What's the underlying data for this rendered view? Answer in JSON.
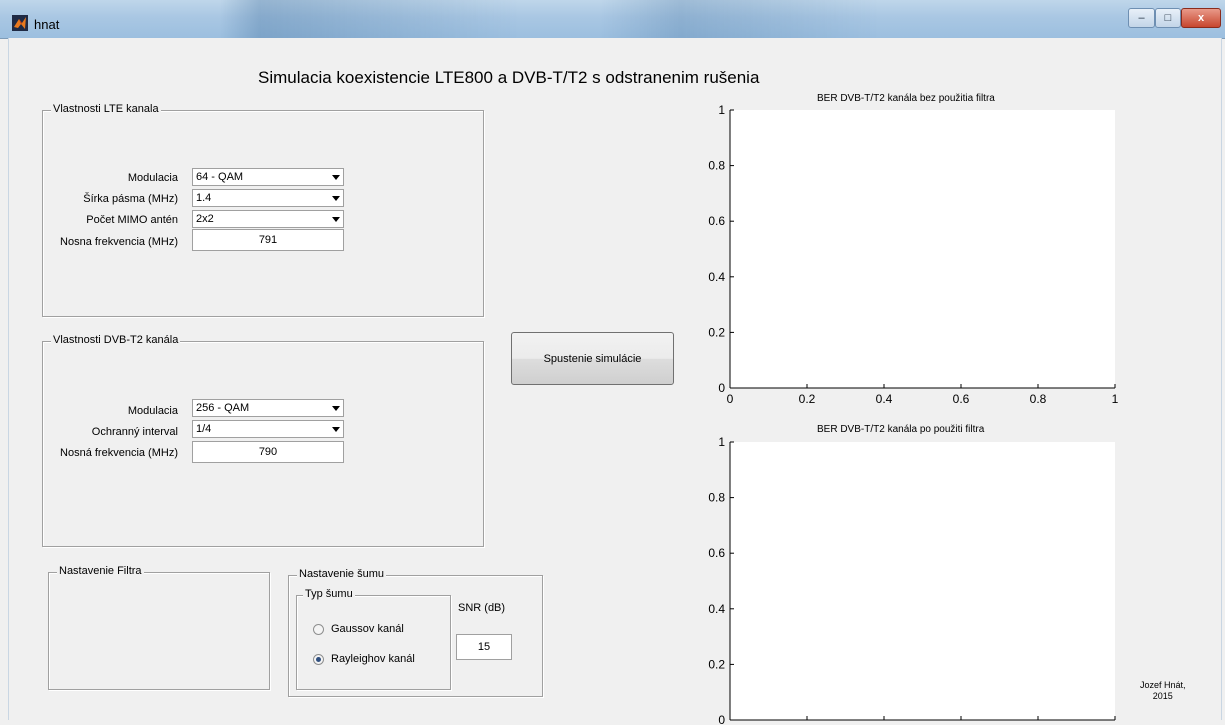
{
  "window": {
    "title": "hnat",
    "minimize_label": "–",
    "maximize_label": "□",
    "close_label": "x"
  },
  "heading": "Simulacia koexistencie LTE800 a DVB-T/T2 s odstranenim rušenia",
  "lte": {
    "group_label": "Vlastnosti LTE kanala",
    "modulation_label": "Modulacia",
    "modulation_value": "64 - QAM",
    "bandwidth_label": "Šírka pásma (MHz)",
    "bandwidth_value": "1.4",
    "mimo_label": "Počet MIMO antén",
    "mimo_value": "2x2",
    "freq_label": "Nosna frekvencia (MHz)",
    "freq_value": "791"
  },
  "dvb": {
    "group_label": "Vlastnosti DVB-T2 kanála",
    "modulation_label": "Modulacia",
    "modulation_value": "256 - QAM",
    "guard_label": "Ochranný interval",
    "guard_value": "1/4",
    "freq_label": "Nosná frekvencia (MHz)",
    "freq_value": "790"
  },
  "run_button": "Spustenie simulácie",
  "filter": {
    "group_label": "Nastavenie Filtra"
  },
  "noise": {
    "group_label": "Nastavenie šumu",
    "type_label": "Typ šumu",
    "gauss_label": "Gaussov kanál",
    "rayleigh_label": "Rayleighov kanál",
    "selected": "Rayleighov kanál",
    "snr_label": "SNR (dB)",
    "snr_value": "15"
  },
  "author": {
    "line1": "Jozef Hnát,",
    "line2": "2015"
  },
  "chart_data": [
    {
      "type": "line",
      "title": "BER DVB-T/T2 kanála bez použitia filtra",
      "xlim": [
        0,
        1
      ],
      "ylim": [
        0,
        1
      ],
      "xticks": [
        "0",
        "0.2",
        "0.4",
        "0.6",
        "0.8",
        "1"
      ],
      "yticks": [
        "0",
        "0.2",
        "0.4",
        "0.6",
        "0.8",
        "1"
      ],
      "series": [],
      "grid": false
    },
    {
      "type": "line",
      "title": "BER DVB-T/T2 kanála po použiti filtra",
      "xlim": [
        0,
        1
      ],
      "ylim": [
        0,
        1
      ],
      "xticks": [],
      "yticks": [
        "0",
        "0.2",
        "0.4",
        "0.6",
        "0.8",
        "1"
      ],
      "series": [],
      "grid": false
    }
  ],
  "colors": {
    "axes_background": "#ffffff",
    "window_background": "#f0f0f0"
  }
}
